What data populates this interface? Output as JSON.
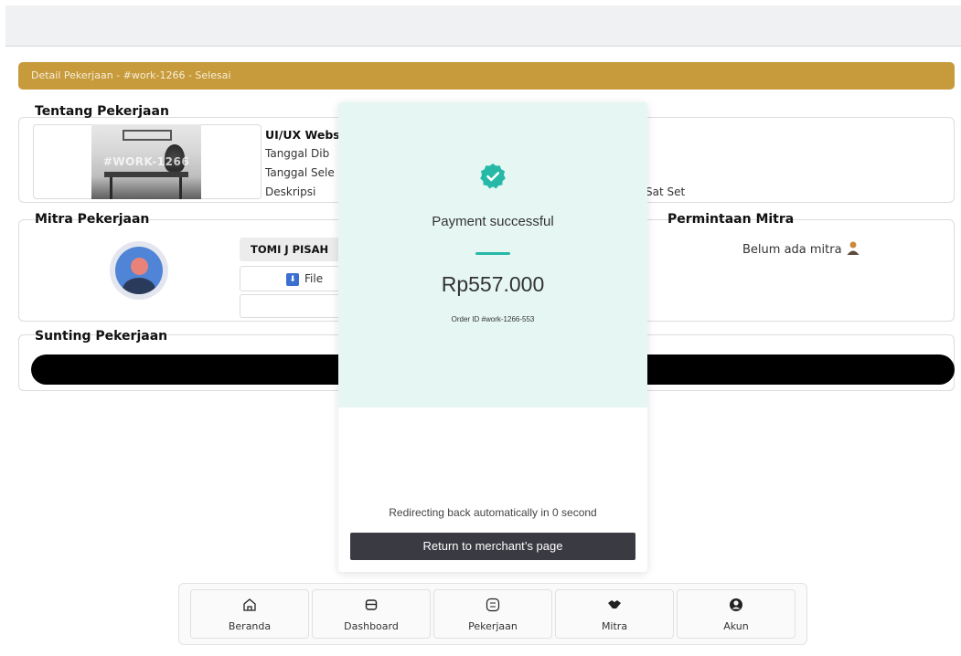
{
  "header": {
    "detail_title": "Detail Pekerjaan - #work-1266 - Selesai"
  },
  "tentang": {
    "section_title": "Tentang Pekerjaan",
    "thumbnail_label": "#WORK-1266",
    "job_title": "UI/UX Webs",
    "tanggal_dibuat_label": "Tanggal Dib",
    "tanggal_selesai_label": "Tanggal Sele",
    "deskripsi_label": "Deskripsi",
    "deskripsi_value": "Sat Set"
  },
  "mitra": {
    "section_title": "Mitra Pekerjaan",
    "name": "TOMI J PISAH",
    "file_label": "File"
  },
  "permintaan": {
    "section_title": "Permintaan Mitra",
    "empty_text": "Belum ada mitra"
  },
  "sunting": {
    "section_title": "Sunting Pekerjaan"
  },
  "modal": {
    "status_title": "Payment successful",
    "amount": "Rp557.000",
    "order_id": "Order ID #work-1266-553",
    "redirect_text": "Redirecting back automatically in 0 second",
    "return_button": "Return to merchant’s page",
    "accent_color": "#26b9a8"
  },
  "bottom_nav": {
    "items": [
      {
        "label": "Beranda",
        "icon": "home-icon"
      },
      {
        "label": "Dashboard",
        "icon": "dashboard-icon"
      },
      {
        "label": "Pekerjaan",
        "icon": "work-icon"
      },
      {
        "label": "Mitra",
        "icon": "handshake-icon"
      },
      {
        "label": "Akun",
        "icon": "user-circle-icon"
      }
    ]
  },
  "colors": {
    "banner": "#c79a3c",
    "modal_top": "#e6f7f3",
    "button_dark": "#3a3a42"
  }
}
